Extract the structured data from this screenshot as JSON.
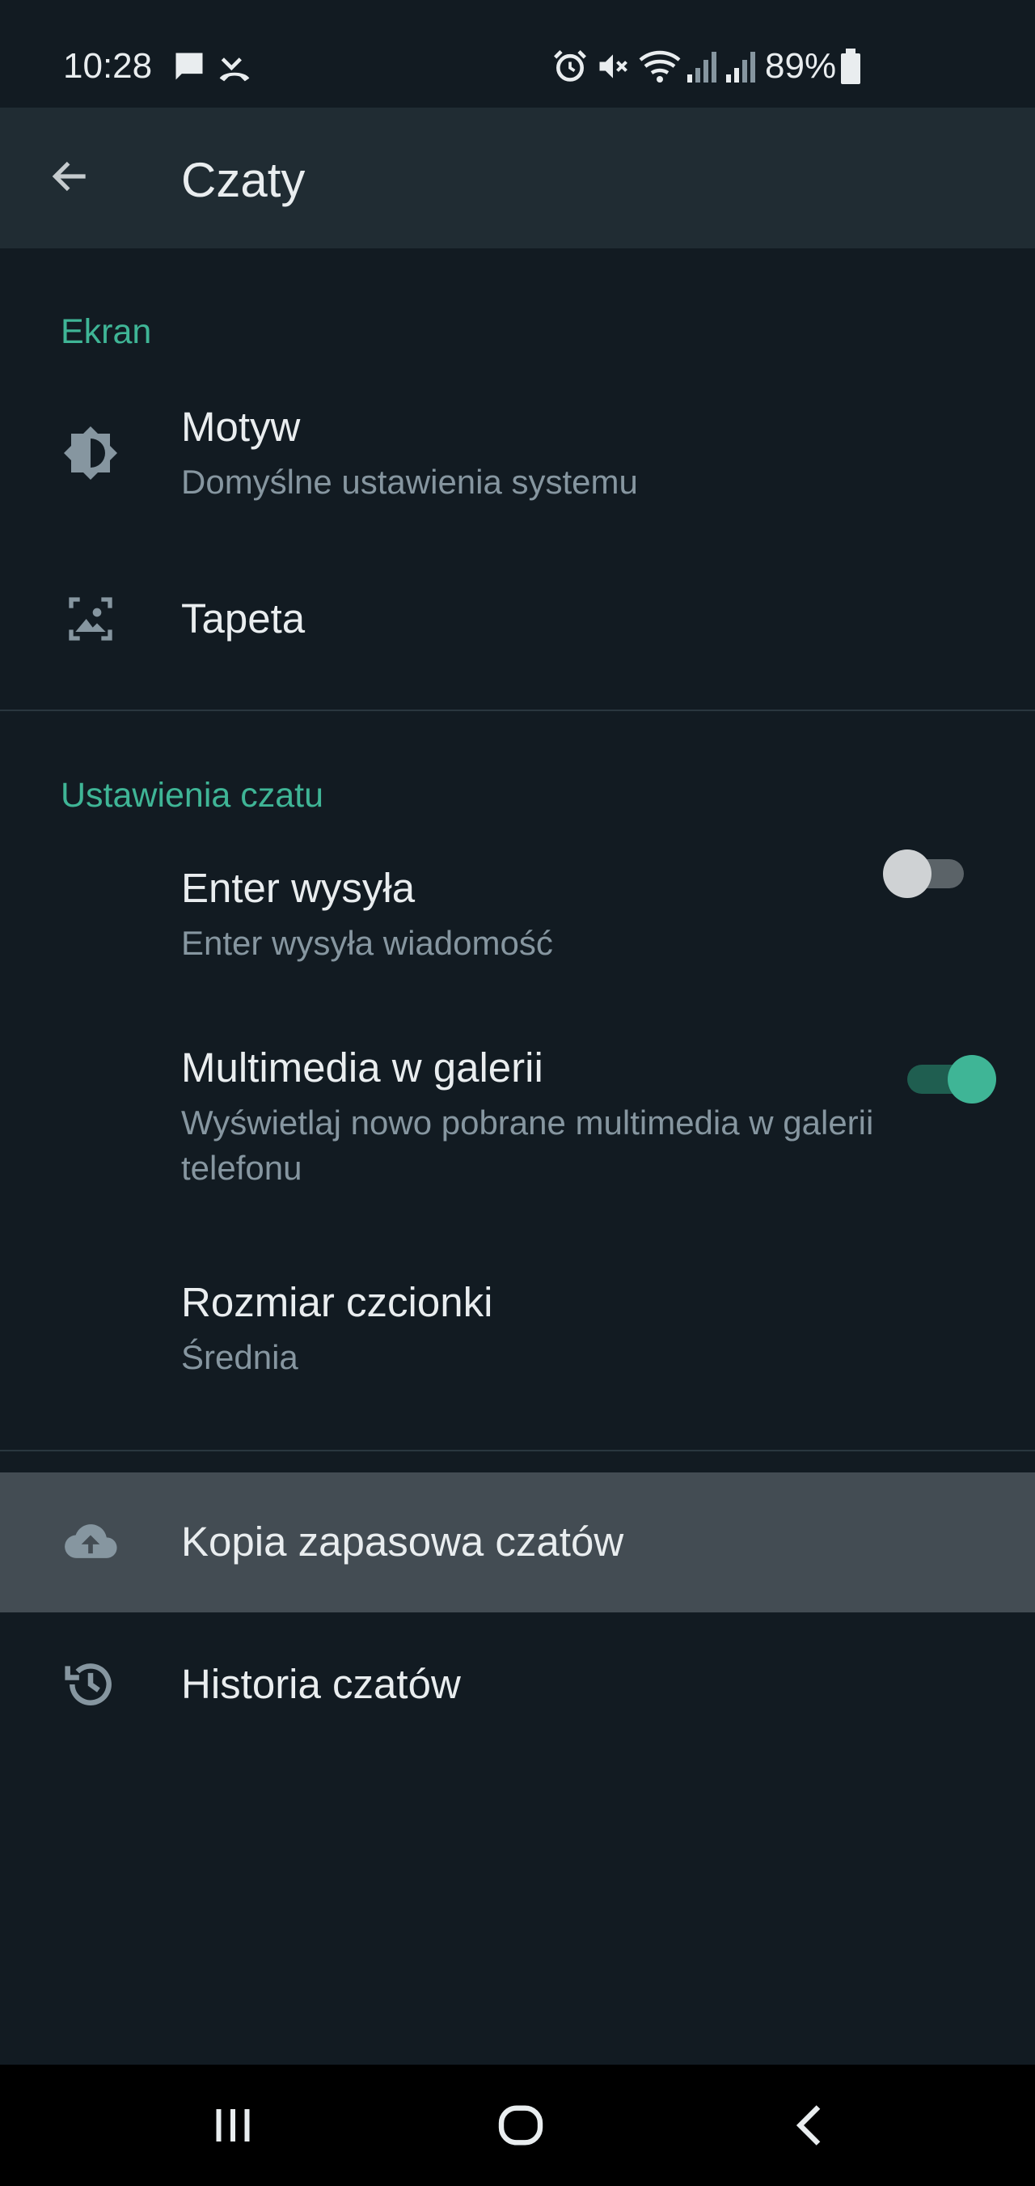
{
  "status_bar": {
    "time": "10:28",
    "battery": "89%"
  },
  "app_bar": {
    "title": "Czaty"
  },
  "sections": {
    "display": {
      "header": "Ekran",
      "theme": {
        "title": "Motyw",
        "subtitle": "Domyślne ustawienia systemu"
      },
      "wallpaper": {
        "title": "Tapeta"
      }
    },
    "chat_settings": {
      "header": "Ustawienia czatu",
      "enter_send": {
        "title": "Enter wysyła",
        "subtitle": "Enter wysyła wiadomość",
        "enabled": false
      },
      "media_visibility": {
        "title": "Multimedia w galerii",
        "subtitle": "Wyświetlaj nowo pobrane multimedia w galerii telefonu",
        "enabled": true
      },
      "font_size": {
        "title": "Rozmiar czcionki",
        "subtitle": "Średnia"
      }
    },
    "backup": {
      "title": "Kopia zapasowa czatów"
    },
    "history": {
      "title": "Historia czatów"
    }
  },
  "colors": {
    "background": "#121b22",
    "app_bar": "#202c33",
    "accent": "#3fb596",
    "highlight": "#434c53",
    "secondary_text": "#8696a0"
  }
}
